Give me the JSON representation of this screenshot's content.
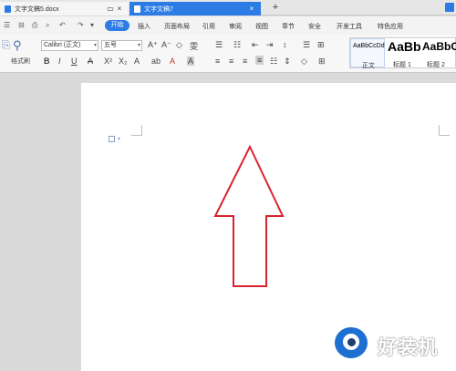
{
  "tabs": [
    {
      "title": "文字文稿5.docx",
      "active": false
    },
    {
      "title": "文字文稿7",
      "active": true
    }
  ],
  "tab_buttons": {
    "restore": "▭",
    "close": "×",
    "new_tab": "+"
  },
  "quick_access": [
    "☰",
    "⊟",
    "⎙",
    "⌕",
    "↶",
    "↷",
    "▾"
  ],
  "menu": {
    "active": "开始",
    "items": [
      "插入",
      "页面布局",
      "引用",
      "审阅",
      "视图",
      "章节",
      "安全",
      "开发工具",
      "特色应用"
    ]
  },
  "ribbon": {
    "format_painter": "格式刷",
    "paste_icon": "⎘",
    "font_name": "Calibri (正文)",
    "font_size": "五号",
    "font_buttons_row1": [
      "A⁺",
      "A⁻",
      "◇",
      "雯"
    ],
    "font_buttons_row2": [
      "B",
      "I",
      "U",
      "A",
      "X²",
      "X₂",
      "A",
      "ab",
      "A",
      "A"
    ],
    "para_row1": [
      "☰",
      "☷",
      "⇤",
      "⇥",
      "↕",
      "☰",
      "⊞"
    ],
    "para_row2": [
      "≡",
      "≡",
      "≡",
      "≡",
      "☷",
      "⇕",
      "◇",
      "⊞"
    ],
    "styles": [
      {
        "preview": "AaBbCcDd",
        "label": "正文"
      },
      {
        "preview": "AaBb",
        "label": "标题 1"
      },
      {
        "preview": "AaBbC",
        "label": "标题 2"
      }
    ]
  },
  "watermark": {
    "text": "好装机"
  },
  "colors": {
    "accent": "#2d7be5",
    "arrow_stroke": "#d9232d"
  }
}
